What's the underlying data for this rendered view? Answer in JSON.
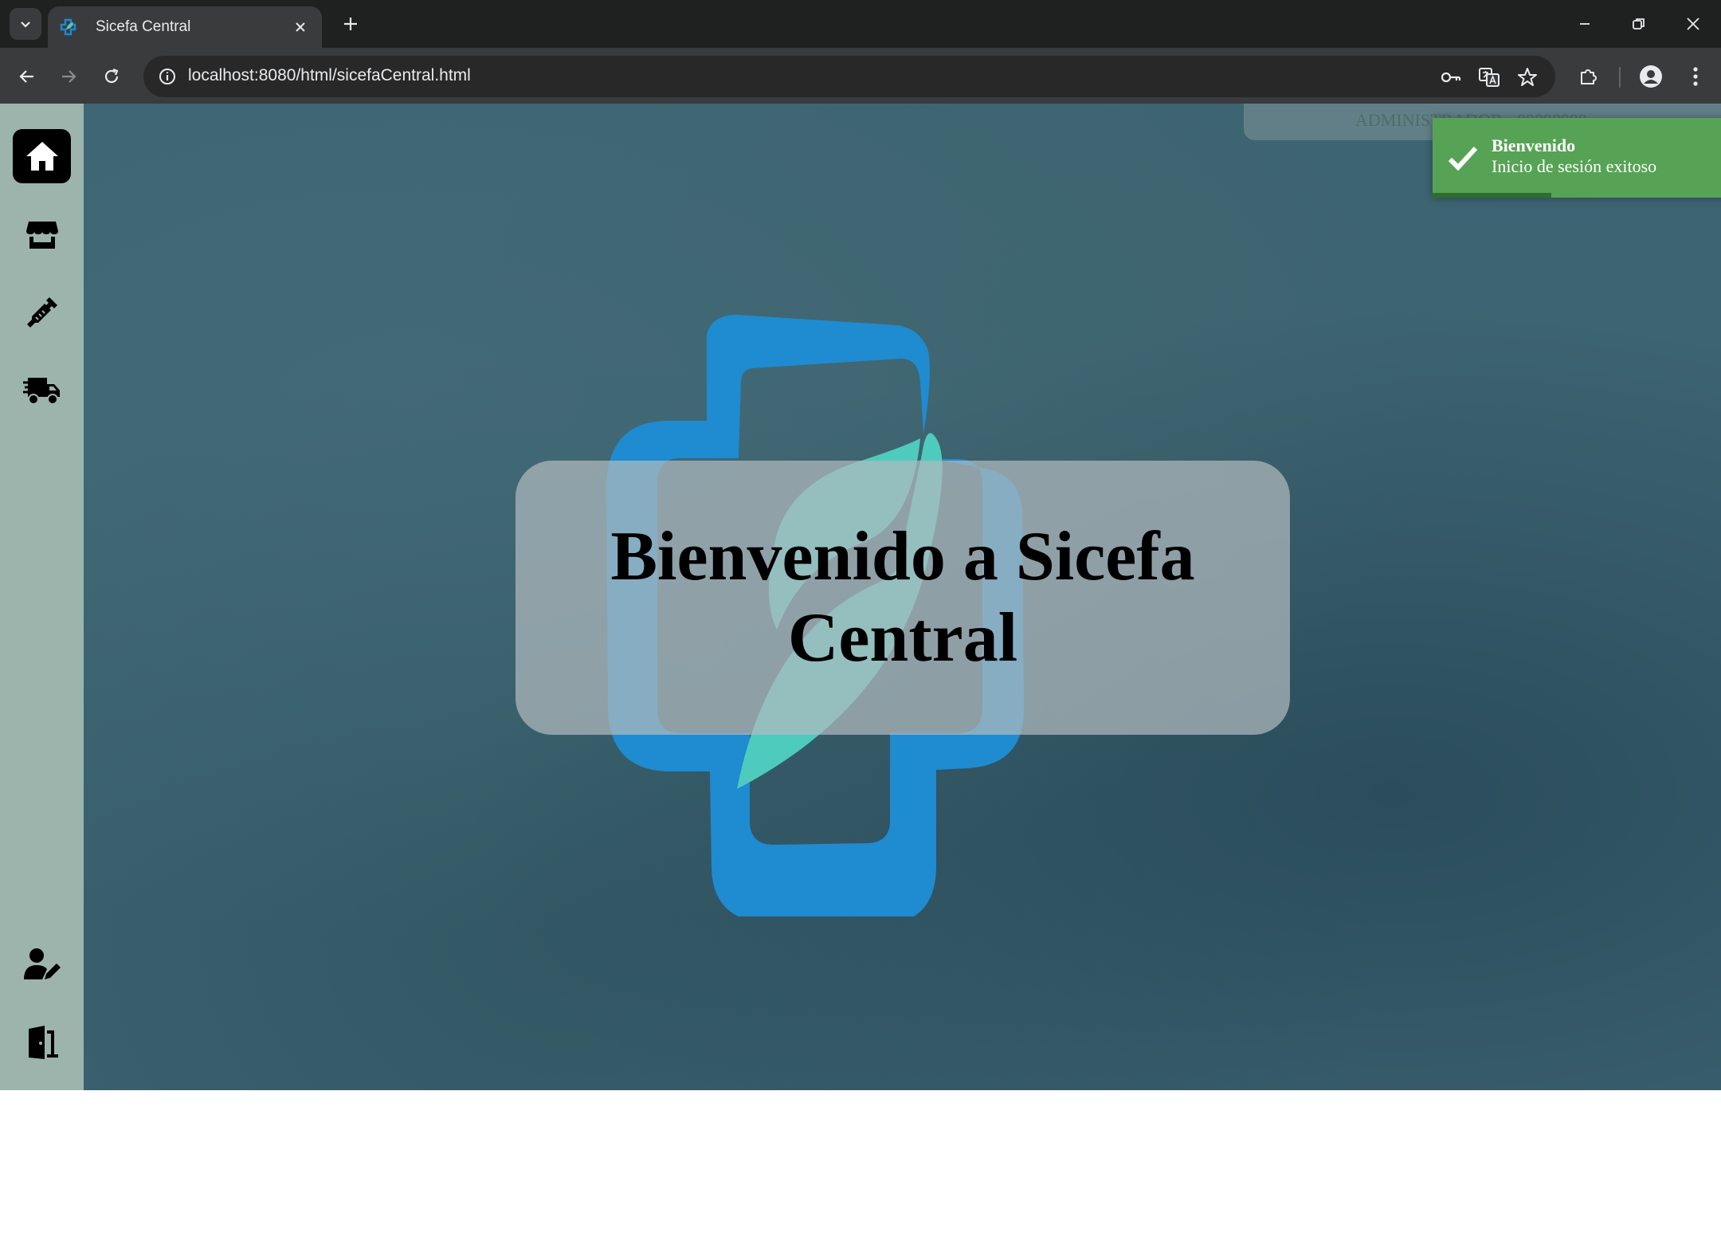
{
  "browser": {
    "tab_title": "Sicefa Central",
    "url_host": "localhost",
    "url_rest": ":8080/html/sicefaCentral.html"
  },
  "sidebar": {
    "items": [
      {
        "name": "home",
        "icon": "home-icon",
        "active": true
      },
      {
        "name": "store",
        "icon": "store-icon",
        "active": false
      },
      {
        "name": "medicine",
        "icon": "syringe-icon",
        "active": false
      },
      {
        "name": "delivery",
        "icon": "truck-icon",
        "active": false
      },
      {
        "name": "user-edit",
        "icon": "user-pen-icon",
        "active": false
      },
      {
        "name": "logout",
        "icon": "door-exit-icon",
        "active": false
      }
    ]
  },
  "main": {
    "user_label": "ADMINISTRADOR - 00000000",
    "welcome_title": "Bienvenido a Sicefa Central"
  },
  "toast": {
    "title": "Bienvenido",
    "message": "Inicio de sesión exitoso",
    "progress": 0.33,
    "color": "#57a355"
  }
}
